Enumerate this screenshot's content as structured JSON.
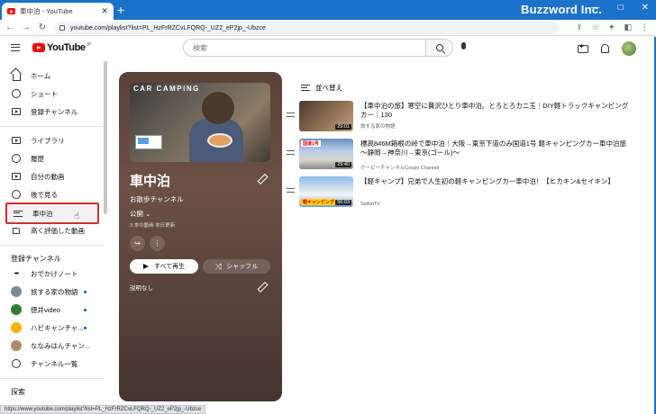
{
  "browser": {
    "tab_title": "車中泊 - YouTube",
    "tab_close": "✕",
    "new_tab": "+",
    "window_controls": [
      "—",
      "□",
      "✕"
    ],
    "watermark": "Buzzword Inc.",
    "nav": [
      "←",
      "→",
      "↻"
    ],
    "url": "youtube.com/playlist?list=PL_HzFrRZCvLFQRQ-_UZ2_eP2jp_-Ubzce",
    "toolbar_icons": [
      "⇪",
      "☆",
      "✦",
      "◧",
      "⋮"
    ],
    "brand_color": "#1a73c9"
  },
  "youtube": {
    "logo_text": "YouTube",
    "logo_region": "JP",
    "search_placeholder": "検索",
    "accent_color": "#ff0000"
  },
  "sidebar": {
    "items": [
      {
        "label": "ホーム",
        "icon": "home-icon"
      },
      {
        "label": "ショート",
        "icon": "shorts-icon"
      },
      {
        "label": "登録チャンネル",
        "icon": "subscriptions-icon"
      },
      {
        "label": "ライブラリ",
        "icon": "library-icon"
      },
      {
        "label": "履歴",
        "icon": "history-icon"
      },
      {
        "label": "自分の動画",
        "icon": "your-videos-icon"
      },
      {
        "label": "後で見る",
        "icon": "watch-later-icon"
      },
      {
        "label": "車中泊",
        "icon": "playlist-icon",
        "active": true
      },
      {
        "label": "高く評価した動画",
        "icon": "liked-icon"
      }
    ],
    "subs_heading": "登録チャンネル",
    "subs": [
      {
        "label": "おでかけノート",
        "icon": "dots-icon",
        "color": "#3b3b3b",
        "new": false
      },
      {
        "label": "旅する家の物語",
        "icon": "channel-avatar-icon",
        "color": "#7a8d96",
        "new": true
      },
      {
        "label": "徳井video",
        "icon": "channel-avatar-icon",
        "color": "#2f7d32",
        "new": true
      },
      {
        "label": "ハピキャンチャ...",
        "icon": "channel-avatar-icon",
        "color": "#f4b400",
        "new": true
      },
      {
        "label": "ななみはんチャン...",
        "icon": "channel-avatar-icon",
        "color": "#b08b6b",
        "new": false
      },
      {
        "label": "チャンネル一覧",
        "icon": "channel-list-icon",
        "color": "#333333",
        "new": false
      }
    ],
    "explore_heading": "探索"
  },
  "playlist": {
    "thumb_caption": "CAR CAMPING",
    "title": "車中泊",
    "owner": "お散歩チャンネル",
    "privacy": "公開",
    "stats": "3 本の動画  本日更新",
    "play_all": "すべて再生",
    "shuffle": "シャッフル",
    "description": "説明なし"
  },
  "list": {
    "sort_label": "並べ替え",
    "videos": [
      {
        "title": "【車中泊の旅】寒空に贅沢ひとり車中泊。とろとろカニ玉｜DIY軽トラックキャンピングカー｜130",
        "channel": "旅する家の物語",
        "duration": "29:01"
      },
      {
        "title": "標高846M箱根の峠で車中泊｜大阪→東京下道のみ国道1号 軽キャンピングカー車中泊旅 ～静岡→神奈川→東京(ゴール)～",
        "channel": "クーピーチャンネルCoupy Channel",
        "duration": "29:40",
        "tag": "国道1号"
      },
      {
        "title": "【軽キャンプ】兄弟で人生初の軽キャンピングカー車中泊！【ヒカキン&セイキン】",
        "channel": "SeikinTV",
        "duration": "56:03",
        "tag": "軽キャンピング"
      }
    ]
  },
  "status_url": "https://www.youtube.com/playlist?list=PL_HzFrRZCvLFQRQ-_UZ2_eP2jp_-Ubzce"
}
